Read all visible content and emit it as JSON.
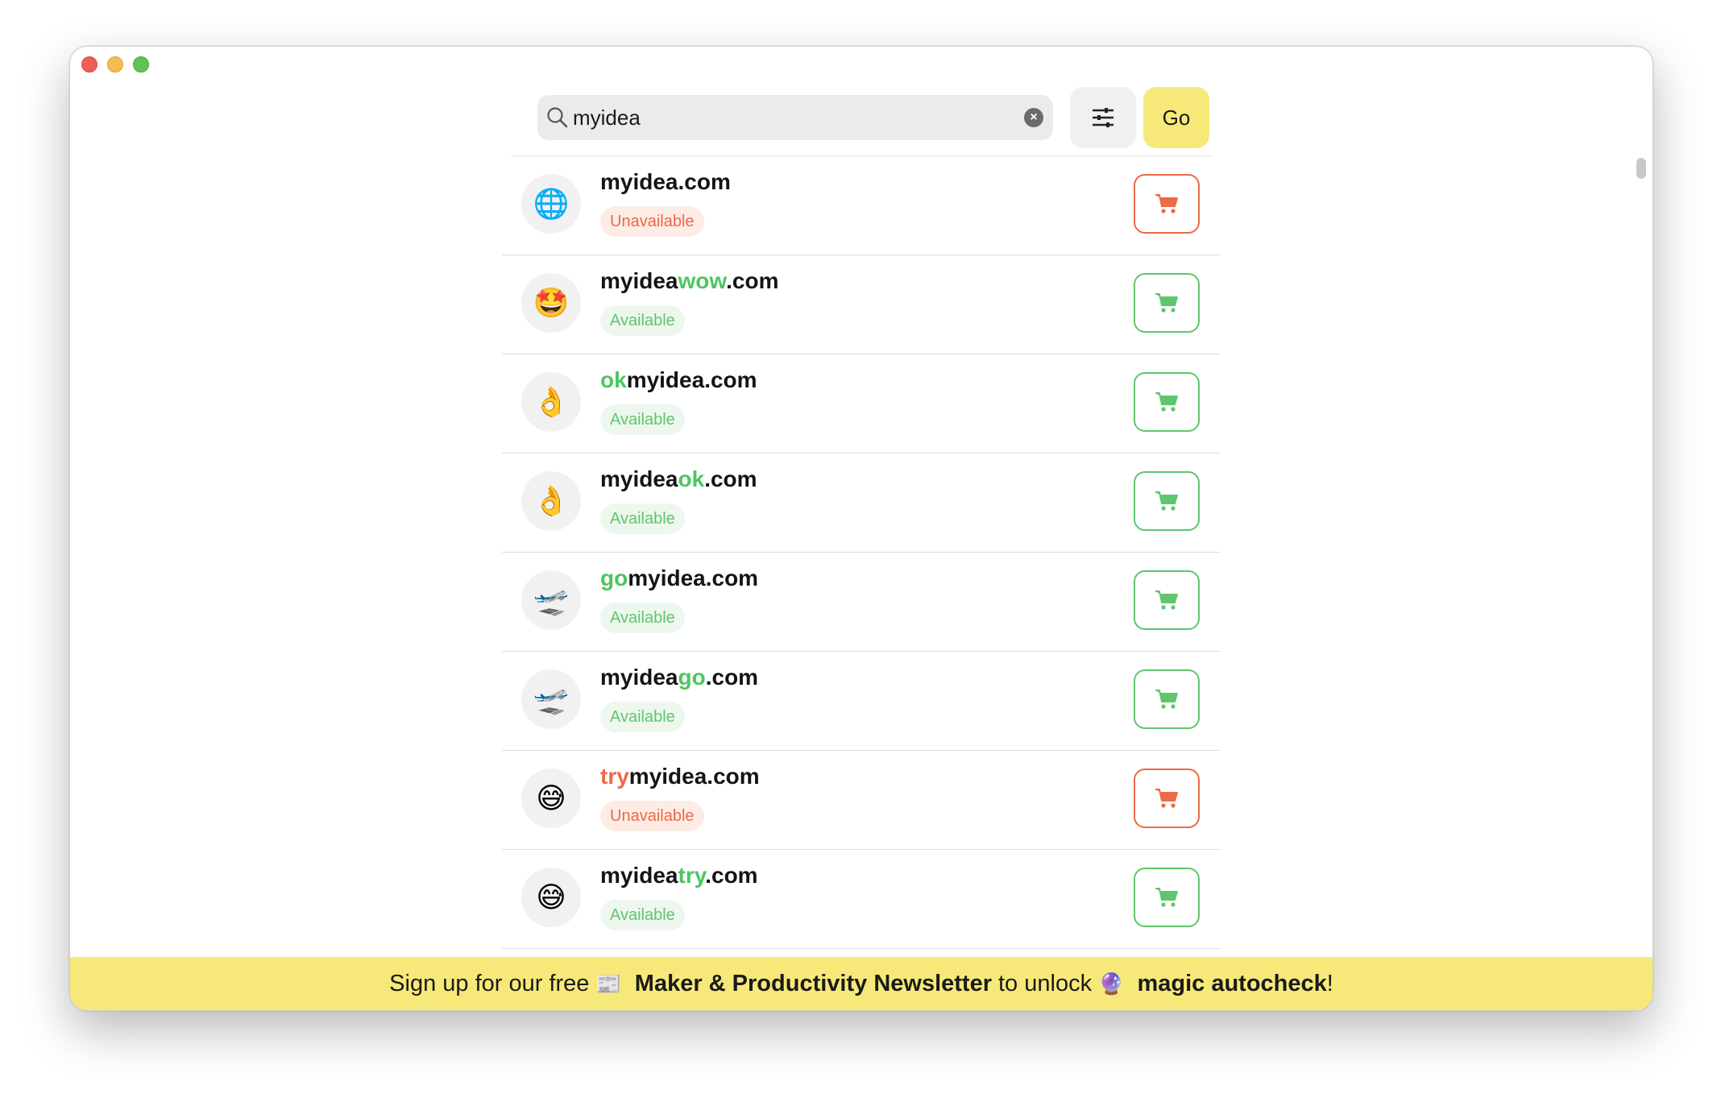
{
  "search": {
    "value": "myidea"
  },
  "toolbar": {
    "go_label": "Go"
  },
  "results": [
    {
      "prefix": "",
      "base": "myidea",
      "suffix": "",
      "tld": ".com",
      "status": "unavailable",
      "status_label": "Unavailable",
      "emoji": "🌐"
    },
    {
      "prefix": "",
      "base": "myidea",
      "suffix": "wow",
      "tld": ".com",
      "status": "available",
      "status_label": "Available",
      "emoji": "🤩"
    },
    {
      "prefix": "ok",
      "base": "myidea",
      "suffix": "",
      "tld": ".com",
      "status": "available",
      "status_label": "Available",
      "emoji": "👌"
    },
    {
      "prefix": "",
      "base": "myidea",
      "suffix": "ok",
      "tld": ".com",
      "status": "available",
      "status_label": "Available",
      "emoji": "👌"
    },
    {
      "prefix": "go",
      "base": "myidea",
      "suffix": "",
      "tld": ".com",
      "status": "available",
      "status_label": "Available",
      "emoji": "🛫"
    },
    {
      "prefix": "",
      "base": "myidea",
      "suffix": "go",
      "tld": ".com",
      "status": "available",
      "status_label": "Available",
      "emoji": "🛫"
    },
    {
      "prefix": "try",
      "base": "myidea",
      "suffix": "",
      "tld": ".com",
      "status": "unavailable",
      "status_label": "Unavailable",
      "emoji": "😅"
    },
    {
      "prefix": "",
      "base": "myidea",
      "suffix": "try",
      "tld": ".com",
      "status": "available",
      "status_label": "Available",
      "emoji": "😅"
    }
  ],
  "banner": {
    "text_1": "Sign up for our free",
    "emoji_1": "📰",
    "bold_1": "Maker & Productivity Newsletter",
    "text_2": "to unlock",
    "emoji_2": "🔮",
    "bold_2": "magic autocheck",
    "text_3": "!"
  },
  "colors": {
    "available": "#5fc66d",
    "unavailable": "#ec6a45",
    "accent_yellow": "#f7e979"
  },
  "icons": [
    "search-icon",
    "clear-icon",
    "filter-icon",
    "cart-icon"
  ]
}
